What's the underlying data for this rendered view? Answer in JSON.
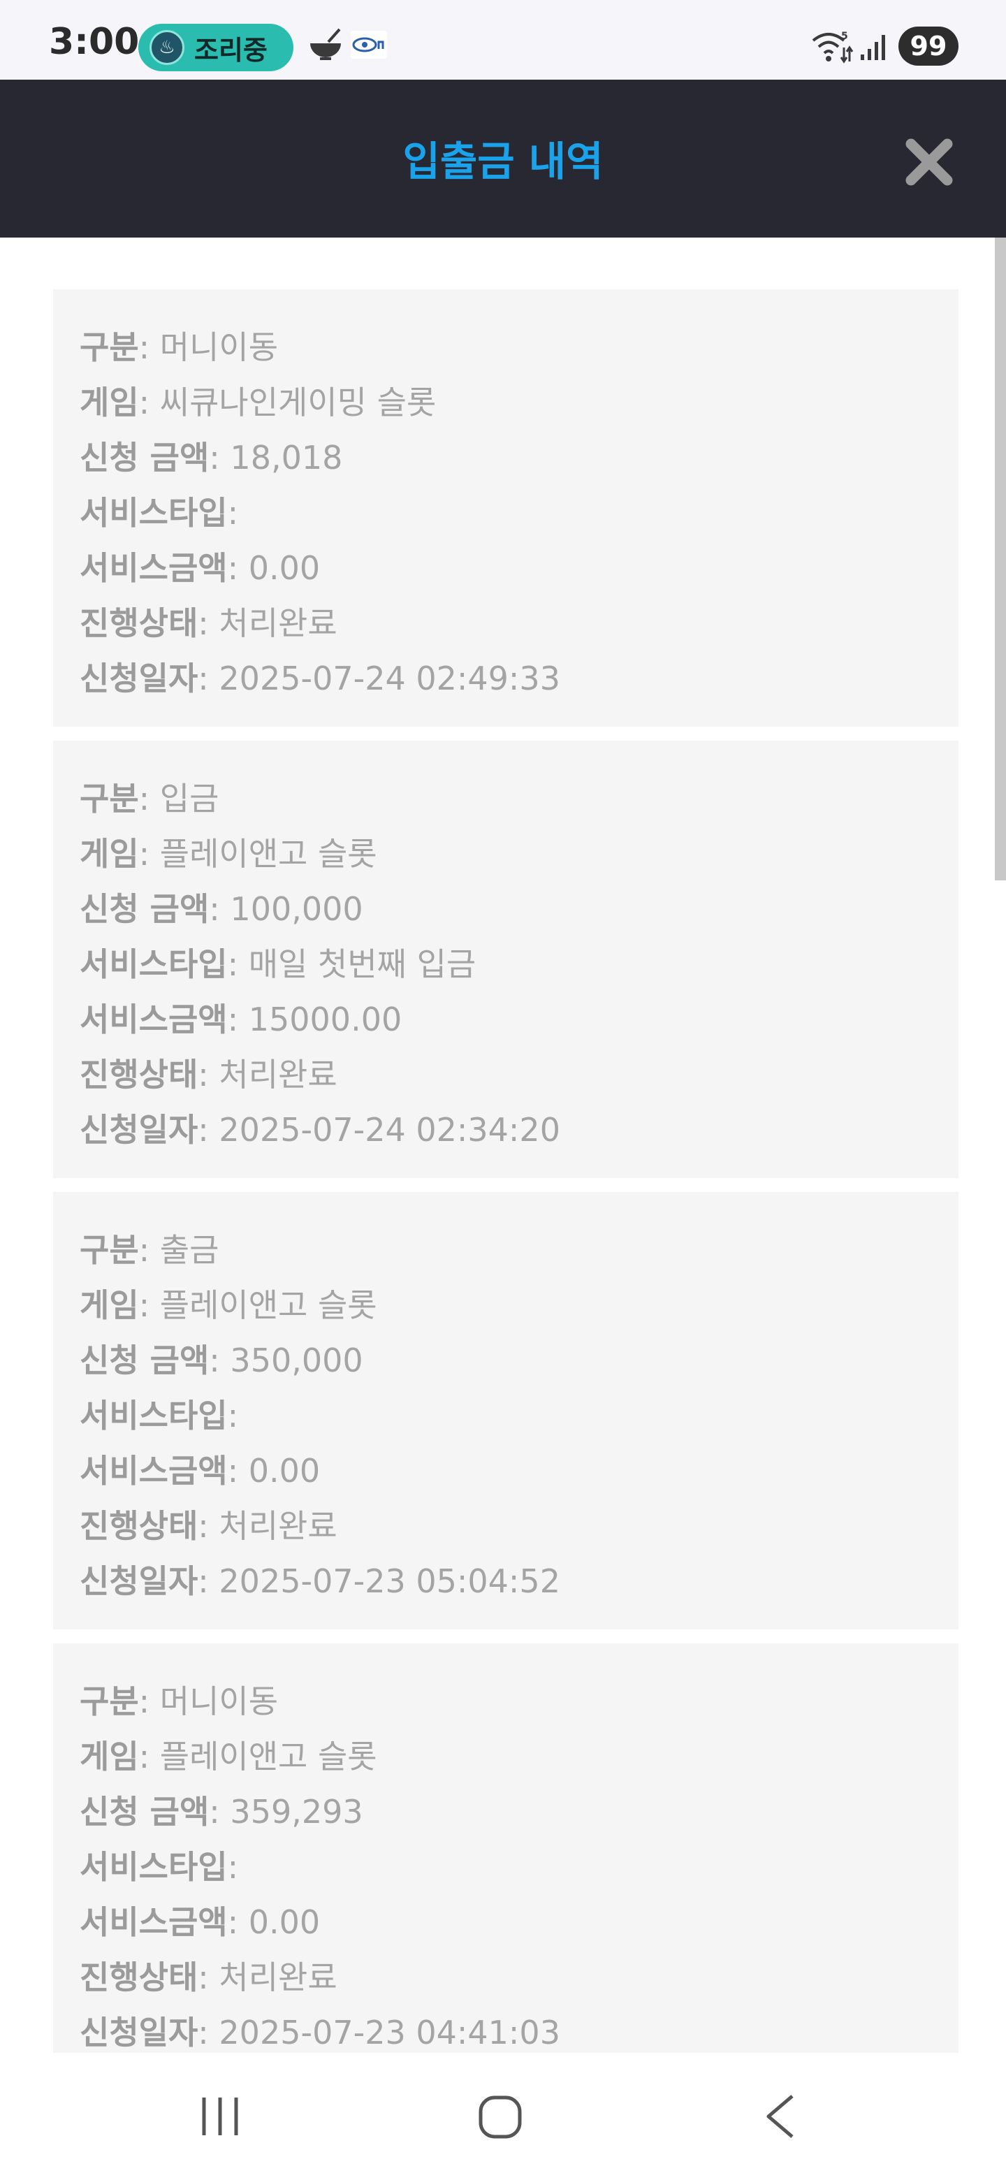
{
  "status_bar": {
    "time": "3:00",
    "cooking_label": "조리중",
    "battery": "99",
    "icons": [
      "bowl-icon",
      "eye-icon",
      "wifi-icon",
      "signal-icon"
    ]
  },
  "header": {
    "title": "입출금 내역",
    "close_icon": "close-icon",
    "title_color": "#1aa3ea",
    "background": "#282833"
  },
  "labels": {
    "type": "구분",
    "game": "게임",
    "amount": "신청 금액",
    "service_type": "서비스타입",
    "service_amount": "서비스금액",
    "status": "진행상태",
    "date": "신청일자",
    "separator": ": "
  },
  "transactions": [
    {
      "type": "머니이동",
      "game": "씨큐나인게이밍 슬롯",
      "amount": "18,018",
      "service_type": "",
      "service_amount": "0.00",
      "status": "처리완료",
      "date": "2025-07-24 02:49:33"
    },
    {
      "type": "입금",
      "game": "플레이앤고 슬롯",
      "amount": "100,000",
      "service_type": "매일 첫번째 입금",
      "service_amount": "15000.00",
      "status": "처리완료",
      "date": "2025-07-24 02:34:20"
    },
    {
      "type": "출금",
      "game": "플레이앤고 슬롯",
      "amount": "350,000",
      "service_type": "",
      "service_amount": "0.00",
      "status": "처리완료",
      "date": "2025-07-23 05:04:52"
    },
    {
      "type": "머니이동",
      "game": "플레이앤고 슬롯",
      "amount": "359,293",
      "service_type": "",
      "service_amount": "0.00",
      "status": "처리완료",
      "date": "2025-07-23 04:41:03"
    }
  ],
  "navbar": {
    "icons": [
      "recent-apps-icon",
      "home-icon",
      "back-icon"
    ]
  }
}
